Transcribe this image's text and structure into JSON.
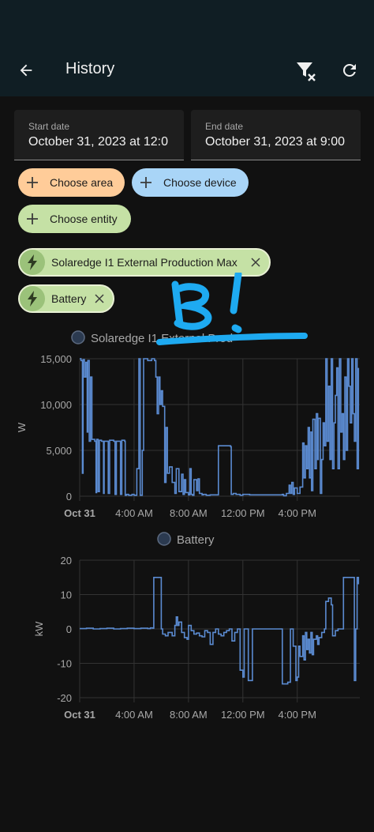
{
  "app_bar": {
    "title": "History"
  },
  "date_range": {
    "start_label": "Start date",
    "start_value": "October 31, 2023 at 12:0",
    "end_label": "End date",
    "end_value": "October 31, 2023 at 9:00"
  },
  "pickers": {
    "area_label": "Choose area",
    "device_label": "Choose device",
    "entity_label": "Choose entity"
  },
  "selected_entities": [
    {
      "name": "Solaredge I1 External Production Max"
    },
    {
      "name": "Battery"
    }
  ],
  "colors": {
    "background": "#111111",
    "header": "#101e24",
    "series_line": "#5b8bd1",
    "area_chip": "#ffcc99",
    "device_chip": "#a9d5f7",
    "entity_chip": "#c5e1a5",
    "annotation": "#1eaaf1"
  },
  "chart_data": [
    {
      "type": "line",
      "legend": [
        "Solaredge I1 External Prod"
      ],
      "ylabel": "W",
      "ylim": [
        0,
        15000
      ],
      "y_ticks": [
        "15,000",
        "10,000",
        "5,000",
        "0"
      ],
      "x_ticks": [
        "Oct 31",
        "4:00 AM",
        "8:00 AM",
        "12:00 PM",
        "4:00 PM"
      ],
      "x_unit": "hours since midnight Oct 31",
      "series": [
        {
          "name": "Solaredge I1 External Prod",
          "points": [
            [
              0.0,
              15000
            ],
            [
              0.1,
              14800
            ],
            [
              0.2,
              2500
            ],
            [
              0.25,
              14900
            ],
            [
              0.35,
              13000
            ],
            [
              0.45,
              14600
            ],
            [
              0.55,
              7000
            ],
            [
              0.6,
              14800
            ],
            [
              0.7,
              6000
            ],
            [
              0.8,
              13000
            ],
            [
              0.9,
              6200
            ],
            [
              1.0,
              6200
            ],
            [
              1.1,
              6000
            ],
            [
              1.2,
              400
            ],
            [
              1.25,
              6200
            ],
            [
              1.35,
              500
            ],
            [
              1.45,
              6100
            ],
            [
              1.6,
              6000
            ],
            [
              1.75,
              300
            ],
            [
              1.8,
              6000
            ],
            [
              2.0,
              6000
            ],
            [
              2.1,
              300
            ],
            [
              2.2,
              6100
            ],
            [
              2.5,
              6000
            ],
            [
              2.6,
              200
            ],
            [
              2.7,
              6000
            ],
            [
              2.9,
              6000
            ],
            [
              3.0,
              200
            ],
            [
              3.1,
              6100
            ],
            [
              3.3,
              6000
            ],
            [
              3.35,
              100
            ],
            [
              3.45,
              200
            ],
            [
              3.6,
              100
            ],
            [
              3.85,
              200
            ],
            [
              4.0,
              100
            ],
            [
              4.2,
              3000
            ],
            [
              4.35,
              15000
            ],
            [
              4.45,
              100
            ],
            [
              4.6,
              5000
            ],
            [
              4.7,
              15000
            ],
            [
              5.0,
              14800
            ],
            [
              5.3,
              15000
            ],
            [
              5.5,
              14800
            ],
            [
              5.6,
              13000
            ],
            [
              5.7,
              9000
            ],
            [
              5.8,
              13000
            ],
            [
              5.9,
              10000
            ],
            [
              6.0,
              11500
            ],
            [
              6.1,
              9800
            ],
            [
              6.25,
              1500
            ],
            [
              6.35,
              7500
            ],
            [
              6.45,
              2500
            ],
            [
              6.6,
              3200
            ],
            [
              6.8,
              1500
            ],
            [
              7.0,
              300
            ],
            [
              7.1,
              3000
            ],
            [
              7.3,
              500
            ],
            [
              7.5,
              2400
            ],
            [
              7.6,
              200
            ],
            [
              7.7,
              1800
            ],
            [
              7.8,
              400
            ],
            [
              8.0,
              150
            ],
            [
              8.1,
              3000
            ],
            [
              8.2,
              200
            ],
            [
              8.3,
              100
            ],
            [
              8.4,
              1800
            ],
            [
              8.6,
              600
            ],
            [
              8.7,
              1900
            ],
            [
              8.8,
              300
            ],
            [
              9.0,
              150
            ],
            [
              9.1,
              200
            ],
            [
              9.3,
              100
            ],
            [
              9.6,
              150
            ],
            [
              10.0,
              150
            ],
            [
              10.2,
              5500
            ],
            [
              10.6,
              5500
            ],
            [
              11.0,
              5500
            ],
            [
              11.1,
              5400
            ],
            [
              11.15,
              200
            ],
            [
              11.3,
              300
            ],
            [
              11.5,
              200
            ],
            [
              11.8,
              100
            ],
            [
              12.0,
              200
            ],
            [
              12.5,
              150
            ],
            [
              13.0,
              150
            ],
            [
              13.5,
              150
            ],
            [
              13.8,
              150
            ],
            [
              14.2,
              150
            ],
            [
              14.5,
              150
            ],
            [
              14.9,
              200
            ],
            [
              15.0,
              50
            ],
            [
              15.2,
              300
            ],
            [
              15.4,
              1200
            ],
            [
              15.5,
              300
            ],
            [
              15.6,
              1500
            ],
            [
              15.7,
              200
            ],
            [
              15.8,
              900
            ],
            [
              16.0,
              300
            ],
            [
              16.2,
              1000
            ],
            [
              16.4,
              5800
            ],
            [
              16.5,
              2000
            ],
            [
              16.6,
              5500
            ],
            [
              16.7,
              3000
            ],
            [
              16.8,
              7500
            ],
            [
              16.9,
              2000
            ],
            [
              17.0,
              7000
            ],
            [
              17.05,
              600
            ],
            [
              17.15,
              8400
            ],
            [
              17.3,
              3000
            ],
            [
              17.4,
              9000
            ],
            [
              17.5,
              4000
            ],
            [
              17.55,
              8500
            ],
            [
              17.7,
              300
            ],
            [
              17.8,
              4000
            ],
            [
              17.9,
              8000
            ],
            [
              18.0,
              5500
            ],
            [
              18.1,
              15000
            ],
            [
              18.2,
              6000
            ],
            [
              18.3,
              12000
            ],
            [
              18.4,
              4000
            ],
            [
              18.5,
              15000
            ],
            [
              18.6,
              3000
            ],
            [
              18.7,
              8000
            ],
            [
              18.8,
              11000
            ],
            [
              18.9,
              14000
            ],
            [
              19.0,
              3000
            ],
            [
              19.1,
              15000
            ],
            [
              19.2,
              7000
            ],
            [
              19.3,
              9000
            ],
            [
              19.4,
              4000
            ],
            [
              19.5,
              13000
            ],
            [
              19.6,
              5000
            ],
            [
              19.7,
              15000
            ],
            [
              19.8,
              12000
            ],
            [
              19.9,
              8000
            ],
            [
              20.0,
              15000
            ],
            [
              20.1,
              9000
            ],
            [
              20.2,
              6000
            ],
            [
              20.3,
              15000
            ],
            [
              20.4,
              3000
            ],
            [
              20.5,
              14000
            ]
          ]
        }
      ]
    },
    {
      "type": "line",
      "legend": [
        "Battery"
      ],
      "ylabel": "kW",
      "ylim": [
        -20,
        20
      ],
      "y_ticks": [
        "20",
        "10",
        "0",
        "-10",
        "-20"
      ],
      "x_ticks": [
        "Oct 31",
        "4:00 AM",
        "8:00 AM",
        "12:00 PM",
        "4:00 PM"
      ],
      "x_unit": "hours since midnight Oct 31",
      "series": [
        {
          "name": "Battery",
          "points": [
            [
              0.0,
              0.1
            ],
            [
              0.5,
              0.2
            ],
            [
              1.0,
              0.0
            ],
            [
              1.5,
              0.1
            ],
            [
              2.0,
              0.2
            ],
            [
              2.5,
              0.0
            ],
            [
              3.0,
              0.1
            ],
            [
              3.5,
              0.2
            ],
            [
              4.0,
              0.1
            ],
            [
              4.5,
              0.2
            ],
            [
              5.0,
              0.1
            ],
            [
              5.2,
              0.3
            ],
            [
              5.4,
              0.2
            ],
            [
              5.45,
              15.0
            ],
            [
              5.8,
              15.0
            ],
            [
              5.9,
              15.0
            ],
            [
              6.0,
              0.0
            ],
            [
              6.1,
              -1.5
            ],
            [
              6.3,
              -2.0
            ],
            [
              6.5,
              -1.0
            ],
            [
              6.8,
              -2.0
            ],
            [
              7.0,
              1.0
            ],
            [
              7.1,
              3.5
            ],
            [
              7.2,
              1.0
            ],
            [
              7.3,
              2.0
            ],
            [
              7.5,
              -1.0
            ],
            [
              7.7,
              -2.5
            ],
            [
              7.9,
              -3.0
            ],
            [
              8.0,
              1.0
            ],
            [
              8.2,
              -0.5
            ],
            [
              8.4,
              -1.5
            ],
            [
              8.6,
              -1.2
            ],
            [
              8.8,
              -2.0
            ],
            [
              9.0,
              -2.3
            ],
            [
              9.2,
              -0.5
            ],
            [
              9.4,
              -1.0
            ],
            [
              9.6,
              -4.5
            ],
            [
              9.8,
              -1.0
            ],
            [
              10.0,
              0.0
            ],
            [
              10.2,
              -1.5
            ],
            [
              10.4,
              -2.0
            ],
            [
              10.6,
              -1.0
            ],
            [
              10.8,
              -0.5
            ],
            [
              11.0,
              0.0
            ],
            [
              11.2,
              -3.5
            ],
            [
              11.4,
              -1.0
            ],
            [
              11.6,
              0.0
            ],
            [
              11.8,
              -12.0
            ],
            [
              12.0,
              -14.0
            ],
            [
              12.1,
              0.0
            ],
            [
              12.4,
              -15.0
            ],
            [
              12.6,
              -15.0
            ],
            [
              12.7,
              0.0
            ],
            [
              13.0,
              0.0
            ],
            [
              13.5,
              0.0
            ],
            [
              14.0,
              0.0
            ],
            [
              14.5,
              0.0
            ],
            [
              14.8,
              0.0
            ],
            [
              14.9,
              -16.0
            ],
            [
              15.3,
              -15.5
            ],
            [
              15.5,
              0.0
            ],
            [
              15.7,
              -5.0
            ],
            [
              15.9,
              -15.0
            ],
            [
              16.0,
              -14.0
            ],
            [
              16.1,
              -5.0
            ],
            [
              16.2,
              -8.0
            ],
            [
              16.4,
              -2.0
            ],
            [
              16.5,
              -9.0
            ],
            [
              16.6,
              -1.0
            ],
            [
              16.7,
              -6.0
            ],
            [
              16.8,
              -3.0
            ],
            [
              16.9,
              -7.0
            ],
            [
              17.0,
              -1.0
            ],
            [
              17.1,
              -7.5
            ],
            [
              17.2,
              -3.0
            ],
            [
              17.4,
              -2.0
            ],
            [
              17.5,
              -4.5
            ],
            [
              17.6,
              -2.5
            ],
            [
              17.8,
              -1.0
            ],
            [
              18.0,
              0.0
            ],
            [
              18.1,
              8.0
            ],
            [
              18.3,
              9.0
            ],
            [
              18.5,
              7.0
            ],
            [
              18.6,
              -2.0
            ],
            [
              18.8,
              -0.5
            ],
            [
              19.0,
              0.0
            ],
            [
              19.2,
              0.0
            ],
            [
              19.4,
              15.0
            ],
            [
              19.8,
              15.0
            ],
            [
              20.0,
              15.0
            ],
            [
              20.1,
              15.0
            ],
            [
              20.2,
              -15.0
            ],
            [
              20.3,
              0.0
            ],
            [
              20.4,
              15.0
            ],
            [
              20.5,
              13.0
            ]
          ]
        }
      ]
    }
  ]
}
